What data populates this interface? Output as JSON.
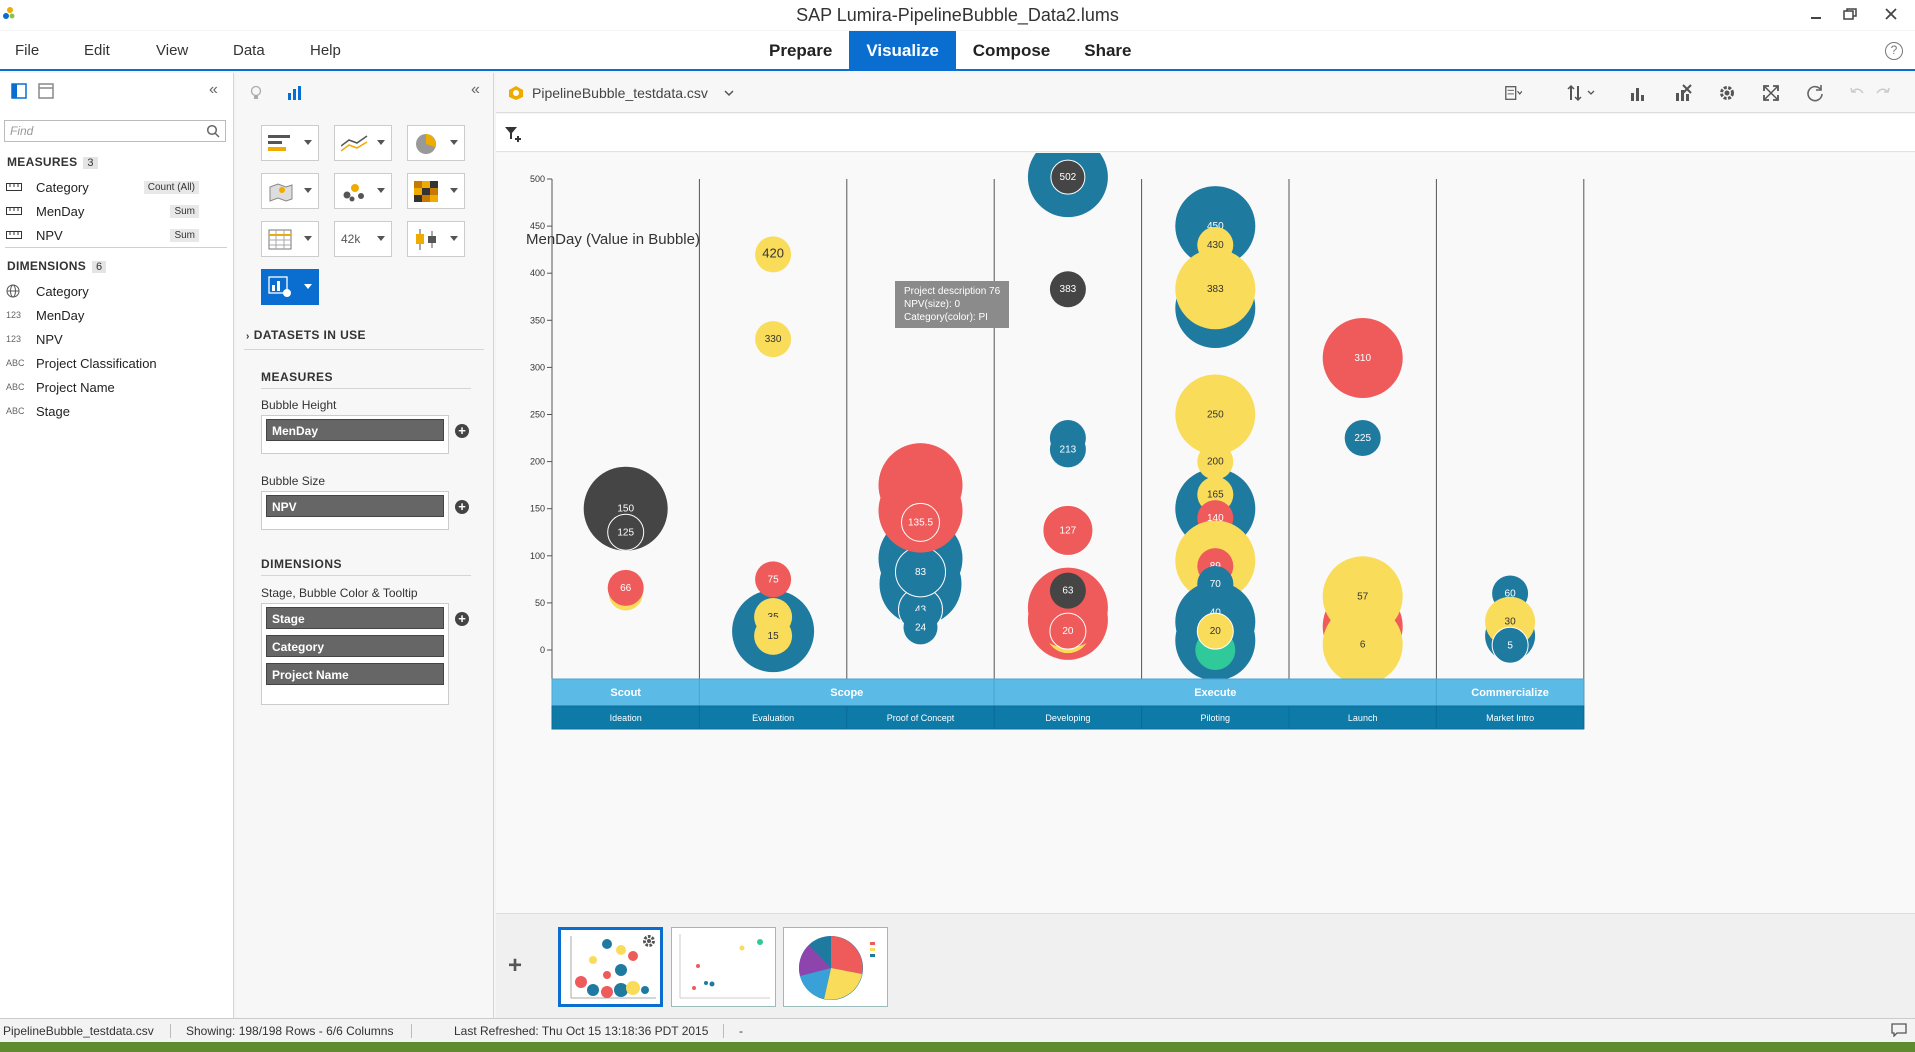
{
  "window": {
    "title": "SAP Lumira-PipelineBubble_Data2.lums"
  },
  "menu": {
    "items": [
      "File",
      "Edit",
      "View",
      "Data",
      "Help"
    ]
  },
  "modes": [
    "Prepare",
    "Visualize",
    "Compose",
    "Share"
  ],
  "active_mode": "Visualize",
  "left_panel": {
    "find_placeholder": "Find",
    "measures_label": "MEASURES",
    "measures_count": "3",
    "measures": [
      {
        "name": "Category",
        "agg": "Count (All)"
      },
      {
        "name": "MenDay",
        "agg": "Sum"
      },
      {
        "name": "NPV",
        "agg": "Sum"
      }
    ],
    "dimensions_label": "DIMENSIONS",
    "dimensions_count": "6",
    "dimensions": [
      {
        "icon": "globe",
        "name": "Category"
      },
      {
        "icon": "123",
        "name": "MenDay"
      },
      {
        "icon": "123",
        "name": "NPV"
      },
      {
        "icon": "ABC",
        "name": "Project Classification"
      },
      {
        "icon": "ABC",
        "name": "Project Name"
      },
      {
        "icon": "ABC",
        "name": "Stage"
      }
    ]
  },
  "builder": {
    "datasets_label": "DATASETS IN USE",
    "measures_label": "MEASURES",
    "bubble_height_label": "Bubble Height",
    "bubble_height_field": "MenDay",
    "bubble_size_label": "Bubble Size",
    "bubble_size_field": "NPV",
    "dimensions_label": "DIMENSIONS",
    "dimension_zone_label": "Stage, Bubble Color & Tooltip",
    "dimension_fields": [
      "Stage",
      "Category",
      "Project Name"
    ],
    "chart_types": [
      "bar",
      "line",
      "pie",
      "geo",
      "scatter",
      "heatmap",
      "table",
      "numeric-point",
      "box-plot",
      "custom-extension"
    ],
    "numeric_point_text": "42k"
  },
  "canvas": {
    "dataset_name": "PipelineBubble_testdata.csv",
    "tooltip": [
      "Project description 76",
      "NPV(size): 0",
      "Category(color): PI"
    ]
  },
  "chart_data": {
    "type": "scatter",
    "title": "MenDay (Value in Bubble)",
    "ylim": [
      -20,
      520
    ],
    "yticks": [
      0,
      50,
      100,
      150,
      200,
      250,
      300,
      350,
      400,
      450,
      500
    ],
    "colors": {
      "blue": "#1f7aa0",
      "yellow": "#fadc5b",
      "red": "#ef5a5a",
      "dark": "#454545",
      "green": "#2fc99a"
    },
    "stage_groups": [
      {
        "label": "Scout",
        "span": [
          0,
          1
        ]
      },
      {
        "label": "Scope",
        "span": [
          1,
          3
        ]
      },
      {
        "label": "Execute",
        "span": [
          3,
          6
        ]
      },
      {
        "label": "Commercialize",
        "span": [
          6,
          7
        ]
      }
    ],
    "stages": [
      "Ideation",
      "Evaluation",
      "Proof of Concept",
      "Developing",
      "Piloting",
      "Launch",
      "Market Intro"
    ],
    "bubbles": [
      {
        "stage": 0,
        "y": 150,
        "r": 42,
        "c": "dark",
        "label": "150"
      },
      {
        "stage": 0,
        "y": 125,
        "r": 18,
        "c": "dark",
        "label": "125",
        "ring": true
      },
      {
        "stage": 0,
        "y": 60,
        "r": 17,
        "c": "yellow",
        "label": ""
      },
      {
        "stage": 0,
        "y": 66,
        "r": 18,
        "c": "red",
        "label": "66"
      },
      {
        "stage": 1,
        "y": 420,
        "r": 18,
        "c": "yellow",
        "label": "420"
      },
      {
        "stage": 1,
        "y": 330,
        "r": 18,
        "c": "yellow",
        "label": "330"
      },
      {
        "stage": 1,
        "y": 20,
        "r": 41,
        "c": "blue",
        "label": ""
      },
      {
        "stage": 1,
        "y": 75,
        "r": 18,
        "c": "red",
        "label": "75"
      },
      {
        "stage": 1,
        "y": 35,
        "r": 19,
        "c": "yellow",
        "label": "35"
      },
      {
        "stage": 1,
        "y": 15,
        "r": 19,
        "c": "yellow",
        "label": "15"
      },
      {
        "stage": 2,
        "y": 175,
        "r": 42,
        "c": "red",
        "label": ""
      },
      {
        "stage": 2,
        "y": 70,
        "r": 41,
        "c": "blue",
        "label": ""
      },
      {
        "stage": 2,
        "y": 97,
        "r": 42,
        "c": "blue",
        "label": ""
      },
      {
        "stage": 2,
        "y": 43,
        "r": 22,
        "c": "blue",
        "label": "43",
        "ring": true
      },
      {
        "stage": 2,
        "y": 83,
        "r": 25,
        "c": "blue",
        "label": "83",
        "ring": true
      },
      {
        "stage": 2,
        "y": 148,
        "r": 42,
        "c": "red",
        "label": ""
      },
      {
        "stage": 2,
        "y": 135.5,
        "r": 19,
        "c": "red",
        "label": "135.5",
        "ring": true
      },
      {
        "stage": 2,
        "y": 24,
        "r": 17,
        "c": "blue",
        "label": "24"
      },
      {
        "stage": 3,
        "y": 502,
        "r": 40,
        "c": "blue",
        "label": ""
      },
      {
        "stage": 3,
        "y": 502,
        "r": 17,
        "c": "dark",
        "label": "502",
        "ring": true
      },
      {
        "stage": 3,
        "y": 383,
        "r": 18,
        "c": "dark",
        "label": "383"
      },
      {
        "stage": 3,
        "y": 225,
        "r": 18,
        "c": "blue",
        "label": ""
      },
      {
        "stage": 3,
        "y": 213,
        "r": 18,
        "c": "blue",
        "label": "213"
      },
      {
        "stage": 3,
        "y": 127,
        "r": 25,
        "c": "red",
        "label": "127",
        "ring": true
      },
      {
        "stage": 3,
        "y": 32,
        "r": 40,
        "c": "red",
        "label": ""
      },
      {
        "stage": 3,
        "y": 20,
        "r": 22,
        "c": "yellow",
        "label": ""
      },
      {
        "stage": 3,
        "y": 45,
        "r": 40,
        "c": "red",
        "label": ""
      },
      {
        "stage": 3,
        "y": 63,
        "r": 18,
        "c": "dark",
        "label": "63"
      },
      {
        "stage": 3,
        "y": 20,
        "r": 18,
        "c": "red",
        "label": "20",
        "ring": true
      },
      {
        "stage": 4,
        "y": 363,
        "r": 40,
        "c": "blue",
        "label": ""
      },
      {
        "stage": 4,
        "y": 450,
        "r": 40,
        "c": "blue",
        "label": "450"
      },
      {
        "stage": 4,
        "y": 430,
        "r": 18,
        "c": "yellow",
        "label": "430"
      },
      {
        "stage": 4,
        "y": 383,
        "r": 40,
        "c": "yellow",
        "label": "383"
      },
      {
        "stage": 4,
        "y": 250,
        "r": 40,
        "c": "yellow",
        "label": "250"
      },
      {
        "stage": 4,
        "y": 150,
        "r": 40,
        "c": "blue",
        "label": ""
      },
      {
        "stage": 4,
        "y": 200,
        "r": 18,
        "c": "yellow",
        "label": "200"
      },
      {
        "stage": 4,
        "y": 165,
        "r": 18,
        "c": "yellow",
        "label": "165"
      },
      {
        "stage": 4,
        "y": 140,
        "r": 18,
        "c": "red",
        "label": "140"
      },
      {
        "stage": 4,
        "y": 95,
        "r": 40,
        "c": "yellow",
        "label": ""
      },
      {
        "stage": 4,
        "y": 89,
        "r": 18,
        "c": "red",
        "label": "89"
      },
      {
        "stage": 4,
        "y": 70,
        "r": 18,
        "c": "red",
        "label": ""
      },
      {
        "stage": 4,
        "y": 10,
        "r": 40,
        "c": "blue",
        "label": ""
      },
      {
        "stage": 4,
        "y": 30,
        "r": 40,
        "c": "blue",
        "label": ""
      },
      {
        "stage": 4,
        "y": 0,
        "r": 20,
        "c": "green",
        "label": ""
      },
      {
        "stage": 4,
        "y": 70,
        "r": 18,
        "c": "blue",
        "label": "70"
      },
      {
        "stage": 4,
        "y": 40,
        "r": 18,
        "c": "blue",
        "label": "40"
      },
      {
        "stage": 4,
        "y": 20,
        "r": 18,
        "c": "yellow",
        "label": "20",
        "ring": true
      },
      {
        "stage": 5,
        "y": 310,
        "r": 40,
        "c": "red",
        "label": "310"
      },
      {
        "stage": 5,
        "y": 225,
        "r": 18,
        "c": "blue",
        "label": "225"
      },
      {
        "stage": 5,
        "y": 25,
        "r": 40,
        "c": "red",
        "label": ""
      },
      {
        "stage": 5,
        "y": 57,
        "r": 40,
        "c": "yellow",
        "label": "57"
      },
      {
        "stage": 5,
        "y": 6,
        "r": 40,
        "c": "yellow",
        "label": "6"
      },
      {
        "stage": 6,
        "y": 60,
        "r": 18,
        "c": "blue",
        "label": "60"
      },
      {
        "stage": 6,
        "y": 15,
        "r": 25,
        "c": "blue",
        "label": ""
      },
      {
        "stage": 6,
        "y": 30,
        "r": 25,
        "c": "yellow",
        "label": "30"
      },
      {
        "stage": 6,
        "y": 5,
        "r": 18,
        "c": "blue",
        "label": "5",
        "ring": true
      }
    ]
  },
  "status": {
    "file": "PipelineBubble_testdata.csv",
    "showing": "Showing: 198/198 Rows - 6/6 Columns",
    "refreshed": "Last Refreshed: Thu Oct 15 13:18:36 PDT 2015",
    "dash": "-"
  }
}
